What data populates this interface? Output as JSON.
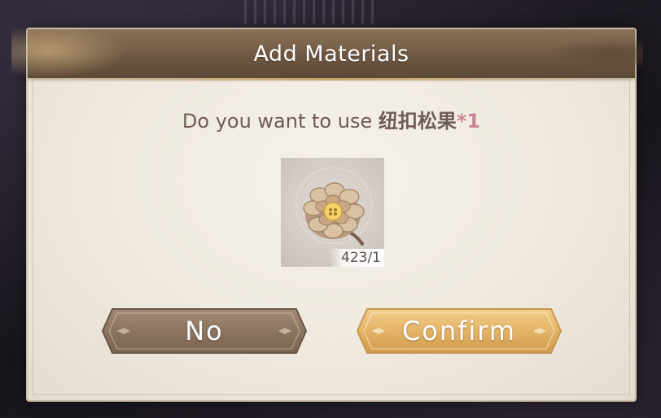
{
  "dialog": {
    "title": "Add Materials",
    "prompt_prefix": "Do you want to use ",
    "item_name": "纽扣松果",
    "quantity_suffix": "*1",
    "item_icon": "pinecone-icon",
    "item_count": "423/1"
  },
  "buttons": {
    "no_label": "No",
    "confirm_label": "Confirm"
  },
  "colors": {
    "banner": "#6f5843",
    "prompt_text": "#6f5b56",
    "quantity_accent": "#c98597",
    "no_button": "#8c7560",
    "confirm_button": "#e3b367"
  }
}
